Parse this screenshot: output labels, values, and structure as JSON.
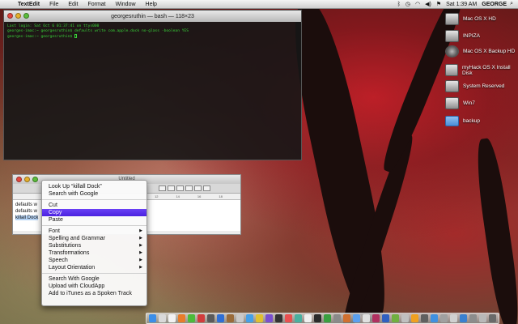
{
  "menubar": {
    "apple": "",
    "app_name": "TextEdit",
    "items": [
      "File",
      "Edit",
      "Format",
      "Window",
      "Help"
    ],
    "clock": "Sat 1:39 AM",
    "user": "GEORGE"
  },
  "terminal": {
    "title": "georgesruthin — bash — 118×23",
    "lines": [
      "Last login: Sat Oct  6 01:37:41 on ttys000",
      "georges-imac:~ georgesruthin$ defaults write com.apple.dock no-glass -boolean YES",
      "georges-imac:~ georgesruthin$ "
    ]
  },
  "textedit": {
    "title": "Untitled",
    "ruler": [
      "12",
      "14",
      "16",
      "18"
    ],
    "lines": [
      "defaults w",
      "defaults w",
      "killall Dock"
    ]
  },
  "context_menu": {
    "items": [
      {
        "label": "Look Up “killall Dock”",
        "submenu": false
      },
      {
        "label": "Search with Google",
        "submenu": false
      },
      {
        "sep": true
      },
      {
        "label": "Cut",
        "submenu": false
      },
      {
        "label": "Copy",
        "submenu": false,
        "highlighted": true
      },
      {
        "label": "Paste",
        "submenu": false
      },
      {
        "sep": true
      },
      {
        "label": "Font",
        "submenu": true
      },
      {
        "label": "Spelling and Grammar",
        "submenu": true
      },
      {
        "label": "Substitutions",
        "submenu": true
      },
      {
        "label": "Transformations",
        "submenu": true
      },
      {
        "label": "Speech",
        "submenu": true
      },
      {
        "label": "Layout Orientation",
        "submenu": true
      },
      {
        "sep": true
      },
      {
        "label": "Search With Google",
        "submenu": false
      },
      {
        "label": "Upload with CloudApp",
        "submenu": false
      },
      {
        "label": "Add to iTunes as a Spoken Track",
        "submenu": false
      }
    ]
  },
  "desktop_icons": [
    {
      "label": "Mac OS X HD",
      "icon": "drive"
    },
    {
      "label": "INPIZA",
      "icon": "drive"
    },
    {
      "label": "Mac OS X Backup HD",
      "icon": "time-machine-drive"
    },
    {
      "label": "myHack OS X Install Disk",
      "icon": "drive"
    },
    {
      "label": "System Reserved",
      "icon": "drive"
    },
    {
      "label": "Win7",
      "icon": "drive"
    },
    {
      "label": "backup",
      "icon": "folder"
    }
  ],
  "dock": {
    "colors": [
      "#3a8ee8",
      "#d9d9d9",
      "#f2f2f2",
      "#e87c2a",
      "#4cbb3a",
      "#d23c3c",
      "#5a5a5a",
      "#2f6fd6",
      "#9a6b3a",
      "#c9c9c9",
      "#45a0e8",
      "#e0c030",
      "#7a4fd0",
      "#333333",
      "#e85050",
      "#4ab0a0",
      "#f0f0f0",
      "#2b2b2b",
      "#3aa040",
      "#8a8a8a",
      "#d07030",
      "#5aa0f0",
      "#e0e0e0",
      "#b03060",
      "#3060c0",
      "#70b040",
      "#c0c0c0",
      "#f0a020",
      "#606060",
      "#4090e0",
      "#a0a0a0",
      "#d0d0d0",
      "#3a80d0",
      "#8c8c8c",
      "#b8b8b8",
      "#6a6a6a"
    ]
  }
}
